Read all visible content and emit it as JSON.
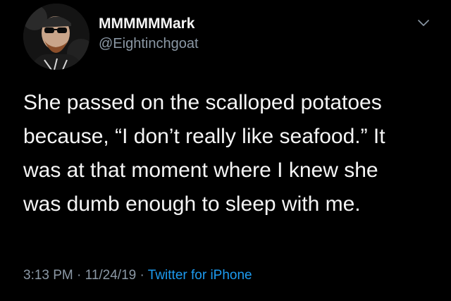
{
  "tweet": {
    "author": {
      "display_name": "MMMMMMark",
      "handle": "@Eightinchgoat",
      "avatar_icon": "profile-photo"
    },
    "menu_icon": "chevron-down-icon",
    "text_lines": [
      "She passed on the scalloped potatoes",
      "because, “I don’t really like seafood.”  It",
      "was at that moment where I knew she",
      "was dumb enough to sleep with me."
    ],
    "time": "3:13 PM",
    "date": "11/24/19",
    "separator": "·",
    "source": "Twitter for iPhone"
  },
  "colors": {
    "background": "#000000",
    "text_primary": "#f5f5f5",
    "text_secondary": "#8b98a5",
    "link": "#1d9bf0"
  }
}
